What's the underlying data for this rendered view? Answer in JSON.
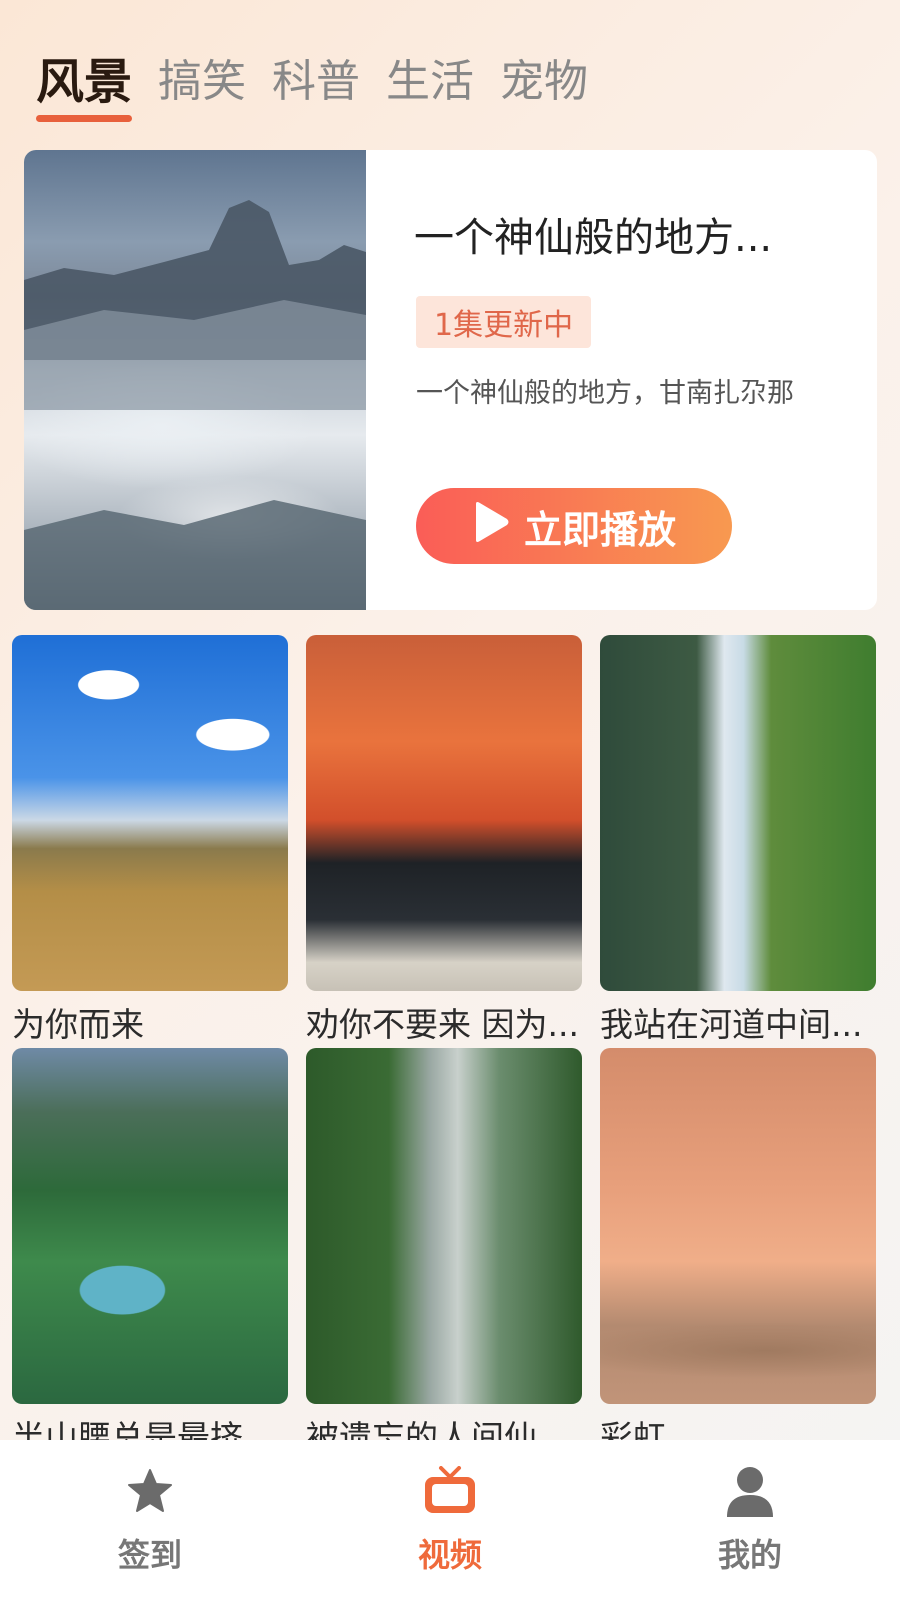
{
  "tabs": [
    {
      "label": "风景",
      "active": true
    },
    {
      "label": "搞笑",
      "active": false
    },
    {
      "label": "科普",
      "active": false
    },
    {
      "label": "生活",
      "active": false
    },
    {
      "label": "宠物",
      "active": false
    }
  ],
  "featured": {
    "title": "一个神仙般的地方...",
    "badge": "1集更新中",
    "description": "一个神仙般的地方，甘南扎尕那",
    "play_label": "立即播放",
    "play_icon": "play-icon"
  },
  "grid": [
    {
      "title": "为你而来"
    },
    {
      "title": "劝你不要来 因为..."
    },
    {
      "title": "我站在河道中间..."
    },
    {
      "title": "半山腰总是最挤..."
    },
    {
      "title": "被遗忘的人间仙..."
    },
    {
      "title": "彩虹"
    }
  ],
  "bottom_nav": [
    {
      "label": "签到",
      "icon": "star-icon",
      "active": false
    },
    {
      "label": "视频",
      "icon": "tv-icon",
      "active": true
    },
    {
      "label": "我的",
      "icon": "user-icon",
      "active": false
    }
  ],
  "colors": {
    "accent": "#ef6a3b",
    "badge_bg": "#fde5da",
    "badge_text": "#e0674a",
    "play_start": "#fa5d57",
    "play_end": "#f89950"
  }
}
